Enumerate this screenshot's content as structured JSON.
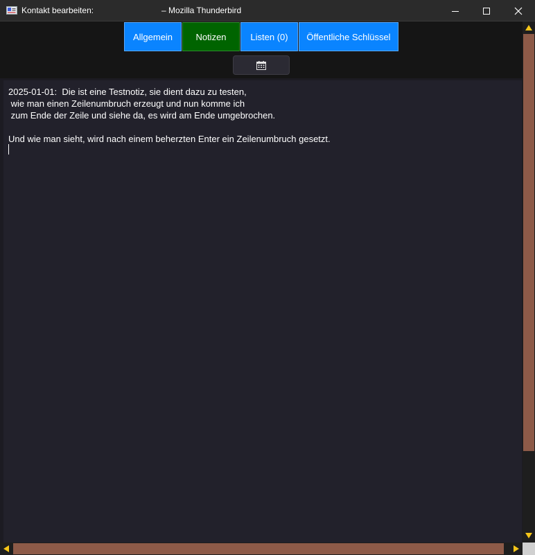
{
  "window": {
    "title_left": "Kontakt bearbeiten:",
    "title_right": "– Mozilla Thunderbird",
    "icon": "contact-card-icon",
    "controls": [
      "minimize-icon",
      "maximize-icon",
      "close-icon"
    ]
  },
  "tabs": [
    {
      "label": "Allgemein",
      "active": false
    },
    {
      "label": "Notizen",
      "active": true
    },
    {
      "label": "Listen (0)",
      "active": false
    },
    {
      "label": "Öffentliche Schlüssel",
      "active": false
    }
  ],
  "toolbar": {
    "date_button_icon": "calendar-icon"
  },
  "note": {
    "text": "2025-01-01:  Die ist eine Testnotiz, sie dient dazu zu testen,\n wie man einen Zeilenumbruch erzeugt und nun komme ich\n zum Ende der Zeile und siehe da, es wird am Ende umgebrochen.\n\nUnd wie man sieht, wird nach einem beherzten Enter ein Zeilenumbruch gesetzt."
  },
  "colors": {
    "tab_blue": "#0a84ff",
    "tab_active_green": "#006400",
    "scrollbar_thumb": "#8d5a48",
    "scroll_arrow": "#f5c518"
  }
}
